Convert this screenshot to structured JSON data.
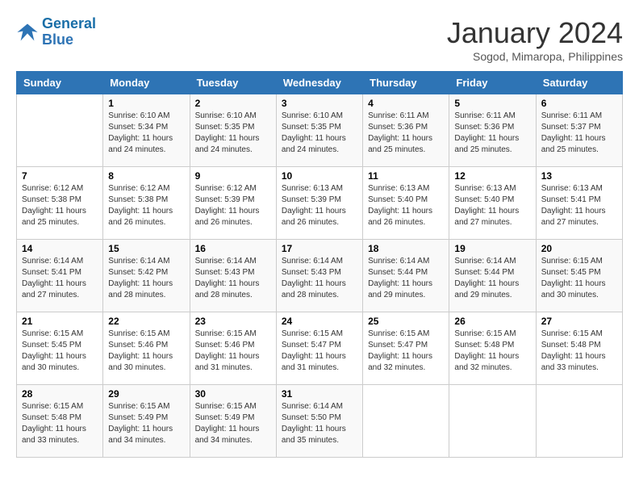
{
  "header": {
    "logo_line1": "General",
    "logo_line2": "Blue",
    "month": "January 2024",
    "location": "Sogod, Mimaropa, Philippines"
  },
  "weekdays": [
    "Sunday",
    "Monday",
    "Tuesday",
    "Wednesday",
    "Thursday",
    "Friday",
    "Saturday"
  ],
  "weeks": [
    [
      {
        "day": "",
        "sunrise": "",
        "sunset": "",
        "daylight": ""
      },
      {
        "day": "1",
        "sunrise": "Sunrise: 6:10 AM",
        "sunset": "Sunset: 5:34 PM",
        "daylight": "Daylight: 11 hours and 24 minutes."
      },
      {
        "day": "2",
        "sunrise": "Sunrise: 6:10 AM",
        "sunset": "Sunset: 5:35 PM",
        "daylight": "Daylight: 11 hours and 24 minutes."
      },
      {
        "day": "3",
        "sunrise": "Sunrise: 6:10 AM",
        "sunset": "Sunset: 5:35 PM",
        "daylight": "Daylight: 11 hours and 24 minutes."
      },
      {
        "day": "4",
        "sunrise": "Sunrise: 6:11 AM",
        "sunset": "Sunset: 5:36 PM",
        "daylight": "Daylight: 11 hours and 25 minutes."
      },
      {
        "day": "5",
        "sunrise": "Sunrise: 6:11 AM",
        "sunset": "Sunset: 5:36 PM",
        "daylight": "Daylight: 11 hours and 25 minutes."
      },
      {
        "day": "6",
        "sunrise": "Sunrise: 6:11 AM",
        "sunset": "Sunset: 5:37 PM",
        "daylight": "Daylight: 11 hours and 25 minutes."
      }
    ],
    [
      {
        "day": "7",
        "sunrise": "Sunrise: 6:12 AM",
        "sunset": "Sunset: 5:38 PM",
        "daylight": "Daylight: 11 hours and 25 minutes."
      },
      {
        "day": "8",
        "sunrise": "Sunrise: 6:12 AM",
        "sunset": "Sunset: 5:38 PM",
        "daylight": "Daylight: 11 hours and 26 minutes."
      },
      {
        "day": "9",
        "sunrise": "Sunrise: 6:12 AM",
        "sunset": "Sunset: 5:39 PM",
        "daylight": "Daylight: 11 hours and 26 minutes."
      },
      {
        "day": "10",
        "sunrise": "Sunrise: 6:13 AM",
        "sunset": "Sunset: 5:39 PM",
        "daylight": "Daylight: 11 hours and 26 minutes."
      },
      {
        "day": "11",
        "sunrise": "Sunrise: 6:13 AM",
        "sunset": "Sunset: 5:40 PM",
        "daylight": "Daylight: 11 hours and 26 minutes."
      },
      {
        "day": "12",
        "sunrise": "Sunrise: 6:13 AM",
        "sunset": "Sunset: 5:40 PM",
        "daylight": "Daylight: 11 hours and 27 minutes."
      },
      {
        "day": "13",
        "sunrise": "Sunrise: 6:13 AM",
        "sunset": "Sunset: 5:41 PM",
        "daylight": "Daylight: 11 hours and 27 minutes."
      }
    ],
    [
      {
        "day": "14",
        "sunrise": "Sunrise: 6:14 AM",
        "sunset": "Sunset: 5:41 PM",
        "daylight": "Daylight: 11 hours and 27 minutes."
      },
      {
        "day": "15",
        "sunrise": "Sunrise: 6:14 AM",
        "sunset": "Sunset: 5:42 PM",
        "daylight": "Daylight: 11 hours and 28 minutes."
      },
      {
        "day": "16",
        "sunrise": "Sunrise: 6:14 AM",
        "sunset": "Sunset: 5:43 PM",
        "daylight": "Daylight: 11 hours and 28 minutes."
      },
      {
        "day": "17",
        "sunrise": "Sunrise: 6:14 AM",
        "sunset": "Sunset: 5:43 PM",
        "daylight": "Daylight: 11 hours and 28 minutes."
      },
      {
        "day": "18",
        "sunrise": "Sunrise: 6:14 AM",
        "sunset": "Sunset: 5:44 PM",
        "daylight": "Daylight: 11 hours and 29 minutes."
      },
      {
        "day": "19",
        "sunrise": "Sunrise: 6:14 AM",
        "sunset": "Sunset: 5:44 PM",
        "daylight": "Daylight: 11 hours and 29 minutes."
      },
      {
        "day": "20",
        "sunrise": "Sunrise: 6:15 AM",
        "sunset": "Sunset: 5:45 PM",
        "daylight": "Daylight: 11 hours and 30 minutes."
      }
    ],
    [
      {
        "day": "21",
        "sunrise": "Sunrise: 6:15 AM",
        "sunset": "Sunset: 5:45 PM",
        "daylight": "Daylight: 11 hours and 30 minutes."
      },
      {
        "day": "22",
        "sunrise": "Sunrise: 6:15 AM",
        "sunset": "Sunset: 5:46 PM",
        "daylight": "Daylight: 11 hours and 30 minutes."
      },
      {
        "day": "23",
        "sunrise": "Sunrise: 6:15 AM",
        "sunset": "Sunset: 5:46 PM",
        "daylight": "Daylight: 11 hours and 31 minutes."
      },
      {
        "day": "24",
        "sunrise": "Sunrise: 6:15 AM",
        "sunset": "Sunset: 5:47 PM",
        "daylight": "Daylight: 11 hours and 31 minutes."
      },
      {
        "day": "25",
        "sunrise": "Sunrise: 6:15 AM",
        "sunset": "Sunset: 5:47 PM",
        "daylight": "Daylight: 11 hours and 32 minutes."
      },
      {
        "day": "26",
        "sunrise": "Sunrise: 6:15 AM",
        "sunset": "Sunset: 5:48 PM",
        "daylight": "Daylight: 11 hours and 32 minutes."
      },
      {
        "day": "27",
        "sunrise": "Sunrise: 6:15 AM",
        "sunset": "Sunset: 5:48 PM",
        "daylight": "Daylight: 11 hours and 33 minutes."
      }
    ],
    [
      {
        "day": "28",
        "sunrise": "Sunrise: 6:15 AM",
        "sunset": "Sunset: 5:48 PM",
        "daylight": "Daylight: 11 hours and 33 minutes."
      },
      {
        "day": "29",
        "sunrise": "Sunrise: 6:15 AM",
        "sunset": "Sunset: 5:49 PM",
        "daylight": "Daylight: 11 hours and 34 minutes."
      },
      {
        "day": "30",
        "sunrise": "Sunrise: 6:15 AM",
        "sunset": "Sunset: 5:49 PM",
        "daylight": "Daylight: 11 hours and 34 minutes."
      },
      {
        "day": "31",
        "sunrise": "Sunrise: 6:14 AM",
        "sunset": "Sunset: 5:50 PM",
        "daylight": "Daylight: 11 hours and 35 minutes."
      },
      {
        "day": "",
        "sunrise": "",
        "sunset": "",
        "daylight": ""
      },
      {
        "day": "",
        "sunrise": "",
        "sunset": "",
        "daylight": ""
      },
      {
        "day": "",
        "sunrise": "",
        "sunset": "",
        "daylight": ""
      }
    ]
  ]
}
